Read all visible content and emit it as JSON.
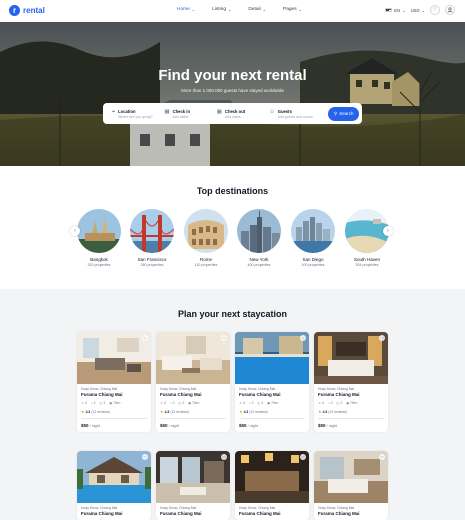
{
  "nav": {
    "logo_letter": "r",
    "logo_text": "rental",
    "menu": [
      {
        "label": "Home",
        "active": true
      },
      {
        "label": "Listing",
        "active": false
      },
      {
        "label": "Detail",
        "active": false
      },
      {
        "label": "Pages",
        "active": false
      }
    ],
    "language": "EN",
    "currency": "USD"
  },
  "hero": {
    "title": "Find your next rental",
    "subtitle": "More than 1.000.000 guests have stayed worldwide",
    "search": {
      "fields": [
        {
          "label": "Location",
          "placeholder": "Where are you going?",
          "icon": "map-pin-icon"
        },
        {
          "label": "Check in",
          "placeholder": "Add dates",
          "icon": "calendar-icon"
        },
        {
          "label": "Check out",
          "placeholder": "Add dates",
          "icon": "calendar-icon"
        },
        {
          "label": "Guests",
          "placeholder": "Add guests and rooms",
          "icon": "user-icon"
        }
      ],
      "button": "Search"
    }
  },
  "destinations": {
    "title": "Top destinations",
    "items": [
      {
        "name": "Bangkok",
        "count": "320 properties"
      },
      {
        "name": "San Francisco",
        "count": "280 properties"
      },
      {
        "name": "Rome",
        "count": "110 properties"
      },
      {
        "name": "New York",
        "count": "400 properties"
      },
      {
        "name": "San Diego",
        "count": "100 properties"
      },
      {
        "name": "South Haven",
        "count": "304 properties"
      }
    ]
  },
  "staycation": {
    "title": "Plan your next staycation",
    "cards": [
      {
        "location": "Hoay Keow, Chiang Mai",
        "name": "Furama Chiang Mai",
        "guests": "4",
        "beds": "2",
        "baths": "2",
        "area": "70m²",
        "rating": "4.3",
        "reviews": "(12 reviews)",
        "price": "$50",
        "unit": "/ night"
      },
      {
        "location": "Hoay Keow, Chiang Mai",
        "name": "Furama Chiang Mai",
        "guests": "4",
        "beds": "2",
        "baths": "2",
        "area": "70m²",
        "rating": "4.3",
        "reviews": "(12 reviews)",
        "price": "$50",
        "unit": "/ night"
      },
      {
        "location": "Hoay Keow, Chiang Mai",
        "name": "Furama Chiang Mai",
        "guests": "4",
        "beds": "2",
        "baths": "2",
        "area": "70m²",
        "rating": "4.3",
        "reviews": "(12 reviews)",
        "price": "$50",
        "unit": "/ night"
      },
      {
        "location": "Hoay Keow, Chiang Mai",
        "name": "Furama Chiang Mai",
        "guests": "4",
        "beds": "2",
        "baths": "2",
        "area": "70m²",
        "rating": "4.3",
        "reviews": "(12 reviews)",
        "price": "$50",
        "unit": "/ night"
      },
      {
        "location": "Hoay Keow, Chiang Mai",
        "name": "Furama Chiang Mai"
      },
      {
        "location": "Hoay Keow, Chiang Mai",
        "name": "Furama Chiang Mai"
      },
      {
        "location": "Hoay Keow, Chiang Mai",
        "name": "Furama Chiang Mai"
      },
      {
        "location": "Hoay Keow, Chiang Mai",
        "name": "Furama Chiang Mai"
      }
    ]
  },
  "colors": {
    "accent": "#2563eb",
    "star": "#f59e0b"
  }
}
